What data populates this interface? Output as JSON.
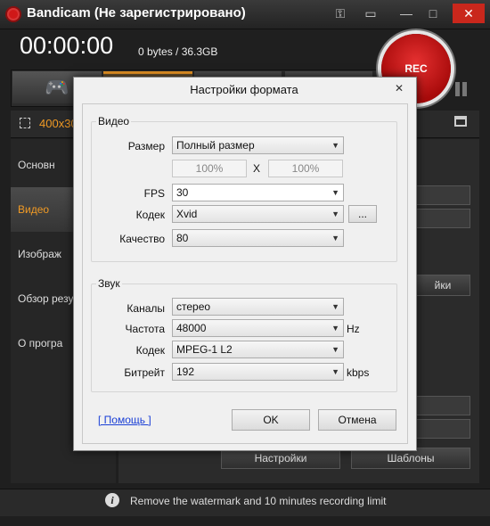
{
  "app": {
    "title": "Bandicam (Не зарегистрировано)",
    "timer": "00:00:00",
    "file_size": "0 bytes / 36.3GB",
    "rec_label": "REC",
    "capture_mode": "400x30",
    "sidebar": [
      "Основн",
      "Видео",
      "Изображ",
      "Обзор резу",
      "О програ"
    ],
    "buttons": {
      "settings_right": "йки",
      "settings": "Настройки",
      "templates": "Шаблоны"
    },
    "bottom_message": "Remove the watermark and 10 minutes recording limit"
  },
  "dialog": {
    "title": "Настройки формата",
    "close": "✕",
    "video": {
      "group_label": "Видео",
      "size_label": "Размер",
      "size_value": "Полный размер",
      "width_pct": "100%",
      "x_label": "X",
      "height_pct": "100%",
      "fps_label": "FPS",
      "fps_value": "30",
      "codec_label": "Кодек",
      "codec_value": "Xvid",
      "codec_more": "...",
      "quality_label": "Качество",
      "quality_value": "80"
    },
    "audio": {
      "group_label": "Звук",
      "channels_label": "Каналы",
      "channels_value": "стерео",
      "freq_label": "Частота",
      "freq_value": "48000",
      "freq_unit": "Hz",
      "codec_label": "Кодек",
      "codec_value": "MPEG-1 L2",
      "bitrate_label": "Битрейт",
      "bitrate_value": "192",
      "bitrate_unit": "kbps"
    },
    "help": "[ Помощь ]",
    "ok": "OK",
    "cancel": "Отмена"
  }
}
